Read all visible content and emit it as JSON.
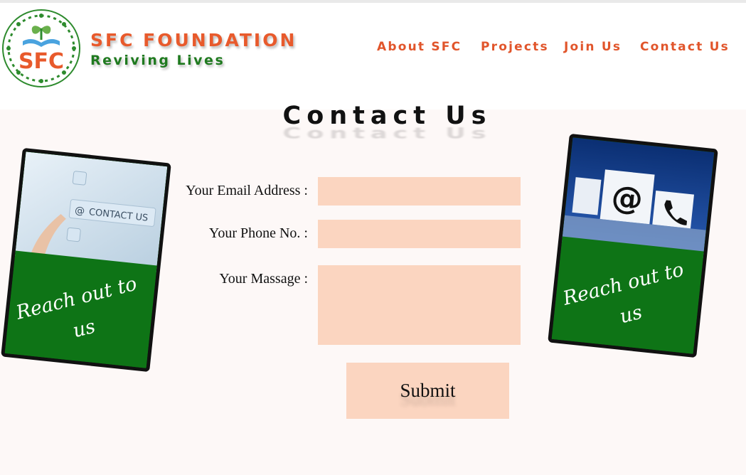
{
  "brand": {
    "logo_text": "SFC",
    "title": "SFC FOUNDATION",
    "tagline": "Reviving Lives",
    "colors": {
      "orange": "#e85a2c",
      "green": "#1f7a1f"
    }
  },
  "nav": {
    "items": [
      {
        "label": "About SFC"
      },
      {
        "label": "Projects"
      },
      {
        "label": "Join Us"
      },
      {
        "label": "Contact Us"
      }
    ]
  },
  "main": {
    "title": "Contact Us",
    "form": {
      "email_label": "Your Email Address :",
      "email_value": "",
      "phone_label": "Your Phone No.  :",
      "phone_value": "",
      "message_label": "Your Massage :",
      "message_value": "",
      "submit_label": "Submit",
      "field_color": "#fbd5c0"
    },
    "cards": {
      "left": {
        "image_text": "CONTACT US",
        "caption": "Reach out to us"
      },
      "right": {
        "image_text": "@",
        "caption": "Reach out to us"
      }
    }
  }
}
